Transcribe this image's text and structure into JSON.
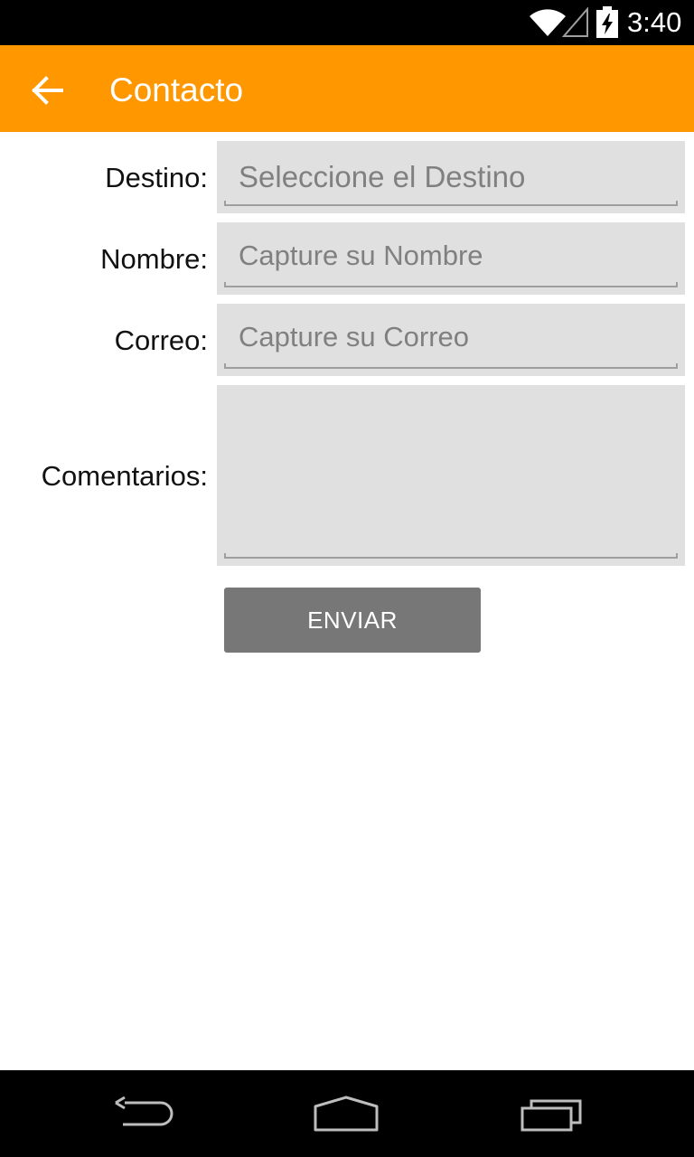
{
  "status_bar": {
    "time": "3:40",
    "icons": [
      "wifi-icon",
      "cell-signal-icon",
      "battery-charging-icon"
    ]
  },
  "app_bar": {
    "title": "Contacto",
    "back_icon": "arrow-left-icon",
    "color": "#ff9800"
  },
  "form": {
    "destino": {
      "label": "Destino:",
      "placeholder": "Seleccione el Destino"
    },
    "nombre": {
      "label": "Nombre:",
      "placeholder": "Capture su Nombre"
    },
    "correo": {
      "label": "Correo:",
      "placeholder": "Capture su Correo"
    },
    "comentarios": {
      "label": "Comentarios:",
      "value": ""
    },
    "submit_label": "ENVIAR"
  },
  "nav_bar": {
    "icons": [
      "back-nav-icon",
      "home-nav-icon",
      "recent-apps-icon"
    ]
  }
}
